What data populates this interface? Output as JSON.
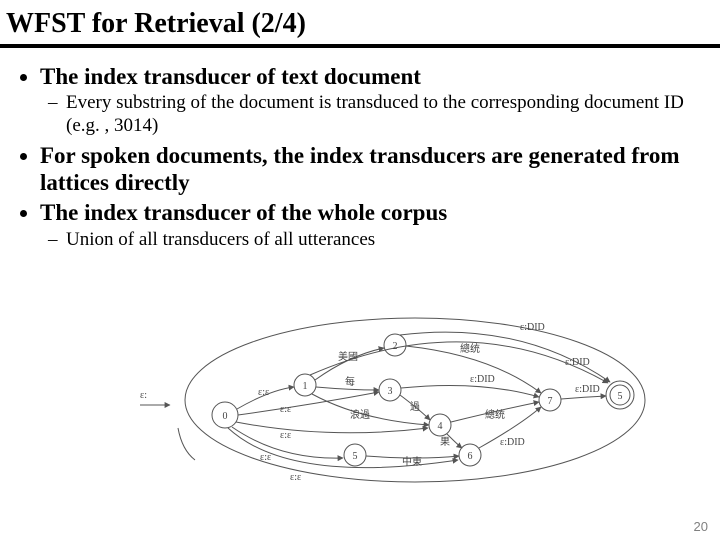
{
  "title": "WFST for Retrieval (2/4)",
  "bullets": {
    "b1": "The index transducer of text document",
    "b1_1": "Every substring of the document is transduced to the corresponding document ID (e.g. , 3014)",
    "b2": "For spoken documents, the index transducers are generated from lattices directly",
    "b3": "The index transducer of the whole corpus",
    "b3_1": "Union of all transducers of all utterances"
  },
  "figure": {
    "left_node": "0",
    "center_start": "0",
    "nodes": {
      "n1": "1",
      "n2": "2",
      "n3": "3",
      "n4": "4",
      "n5": "5",
      "n6": "6",
      "n7": "7",
      "nF": "5"
    },
    "edge_eps": "ε:ε",
    "edge_eps_short": "ε:",
    "edge_did": "ε:DID",
    "edge_a": "美國",
    "edge_b": "每",
    "edge_c": "浪過",
    "edge_d": "過",
    "edge_e": "果",
    "edge_f": "總统",
    "edge_g": "中東"
  },
  "page_number": "20"
}
